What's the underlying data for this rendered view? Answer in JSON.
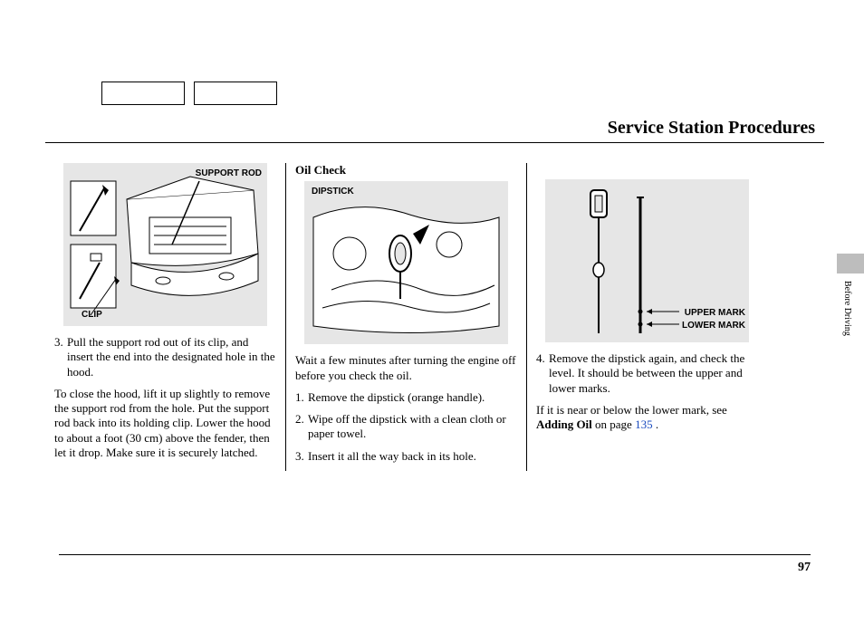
{
  "header": {
    "title": "Service Station Procedures"
  },
  "sideTab": {
    "label": "Before Driving"
  },
  "pageNumber": "97",
  "col1": {
    "fig": {
      "label_top": "SUPPORT ROD",
      "label_bottom": "CLIP"
    },
    "step3_num": "3.",
    "step3": "Pull the support rod out of its clip, and insert the end into the designated hole in the hood.",
    "close_para": "To close the hood, lift it up slightly to remove the support rod from the hole. Put the support rod back into its holding clip. Lower the hood to about a foot (30 cm) above the fender, then let it drop. Make sure it is securely latched."
  },
  "col2": {
    "subhead": "Oil Check",
    "fig": {
      "label": "DIPSTICK"
    },
    "intro": "Wait a few minutes after turning the engine off before you check the oil.",
    "s1_num": "1.",
    "s1": "Remove the dipstick (orange handle).",
    "s2_num": "2.",
    "s2": "Wipe off the dipstick with a clean cloth or paper towel.",
    "s3_num": "3.",
    "s3": "Insert it all the way back in its hole."
  },
  "col3": {
    "fig": {
      "label_upper": "UPPER MARK",
      "label_lower": "LOWER MARK"
    },
    "s4_num": "4.",
    "s4": "Remove the dipstick again, and check the level. It should be between the upper and lower marks.",
    "ref_a": "If it is near or below the lower mark, see ",
    "ref_bold": "Adding Oil",
    "ref_b": " on page ",
    "ref_link": "135",
    "ref_c": " ."
  }
}
